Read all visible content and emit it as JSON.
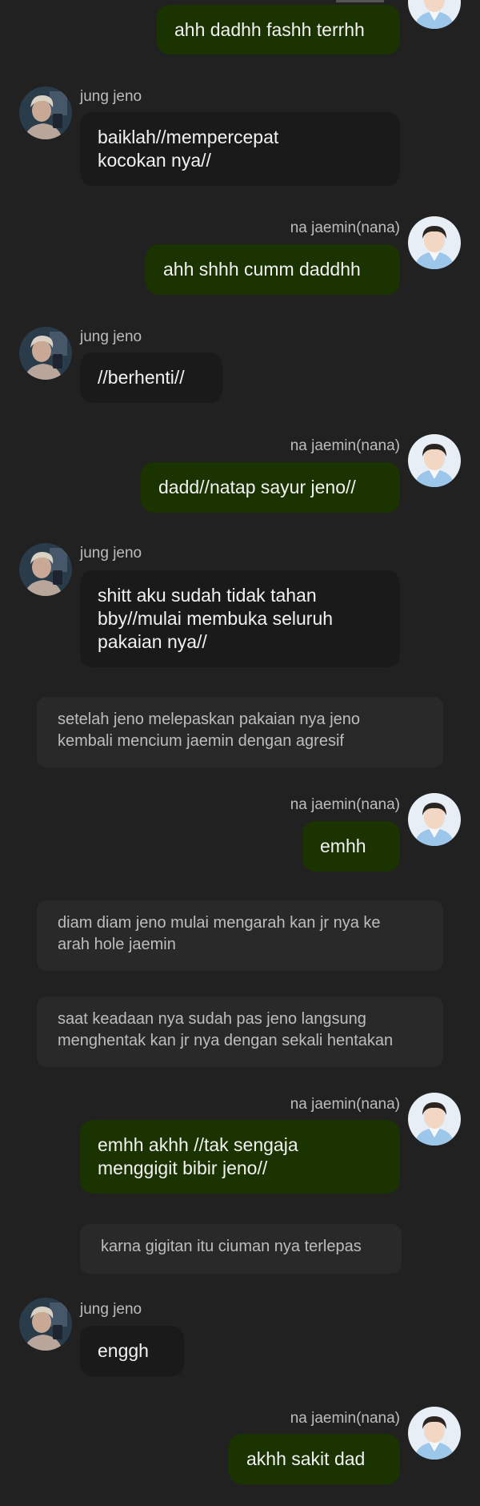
{
  "chat": {
    "jeno_name": "jung jeno",
    "jaemin_name": "na jaemin(nana)",
    "messages": [
      "ahh dadhh fashh terrhh",
      "baiklah//mempercepat\nkocokan nya//",
      "ahh shhh cumm daddhh",
      "//berhenti//",
      "dadd//natap sayur jeno//",
      "shitt aku sudah tidak tahan\nbby//mulai membuka seluruh\npakaian nya//",
      "setelah jeno melepaskan pakaian nya jeno\nkembali mencium jaemin dengan agresif",
      "emhh",
      "diam diam jeno mulai mengarah kan jr nya ke\narah hole jaemin",
      "saat keadaan nya sudah pas jeno langsung\nmenghentak kan jr nya dengan sekali hentakan",
      "emhh akhh //tak sengaja\nmenggigit bibir jeno//",
      "karna gigitan itu ciuman nya terlepas",
      "enggh",
      "akhh sakit dad"
    ]
  },
  "colors": {
    "background": "#212121",
    "incoming_bubble": "#1a1a1a",
    "outgoing_bubble": "#1a3300",
    "narration_bubble": "#292929"
  },
  "icons": {
    "jeno_avatar": "avatar-jeno-photo",
    "jaemin_avatar": "avatar-jaemin-photo"
  }
}
